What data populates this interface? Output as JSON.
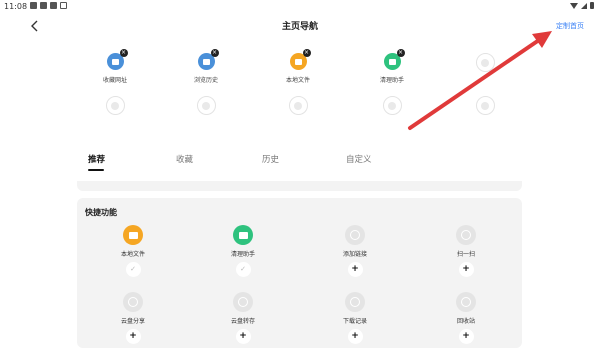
{
  "status_bar": {
    "time": "11:08",
    "icons": [
      "notification-icon",
      "notification-icon",
      "notification-icon",
      "alert-icon",
      "wifi-icon",
      "signal-icon",
      "battery-icon"
    ]
  },
  "header": {
    "back_icon": "back-chevron-icon",
    "title": "主页导航",
    "action_label": "定制首页",
    "action_color": "#3b82f6"
  },
  "home_grid": {
    "row1": [
      {
        "label": "收藏网址",
        "color": "#4a90d9",
        "icon": "bookmark-icon"
      },
      {
        "label": "浏览历史",
        "color": "#4a90d9",
        "icon": "history-icon"
      },
      {
        "label": "本地文件",
        "color": "#f5a623",
        "icon": "folder-icon"
      },
      {
        "label": "清理助手",
        "color": "#2ec27e",
        "icon": "broom-icon"
      }
    ],
    "remove_glyph": "×"
  },
  "tabs": [
    {
      "label": "推荐",
      "active": true
    },
    {
      "label": "收藏",
      "active": false
    },
    {
      "label": "历史",
      "active": false
    },
    {
      "label": "自定义",
      "active": false
    }
  ],
  "quick_functions": {
    "title": "快捷功能",
    "rows": [
      [
        {
          "label": "本地文件",
          "color": "#f5a623",
          "icon": "folder-icon",
          "added": true
        },
        {
          "label": "清理助手",
          "color": "#2ec27e",
          "icon": "broom-icon",
          "added": true
        },
        {
          "label": "添加链接",
          "icon": "globe-icon",
          "added": false
        },
        {
          "label": "扫一扫",
          "icon": "globe-icon",
          "added": false
        }
      ],
      [
        {
          "label": "云盘分享",
          "icon": "globe-icon",
          "added": false
        },
        {
          "label": "云盘转存",
          "icon": "globe-icon",
          "added": false
        },
        {
          "label": "下载记录",
          "icon": "globe-icon",
          "added": false
        },
        {
          "label": "回收站",
          "icon": "globe-icon",
          "added": false
        }
      ]
    ],
    "add_glyph": "+",
    "check_glyph": "✓"
  },
  "annotation": {
    "color": "#e03a3a"
  }
}
